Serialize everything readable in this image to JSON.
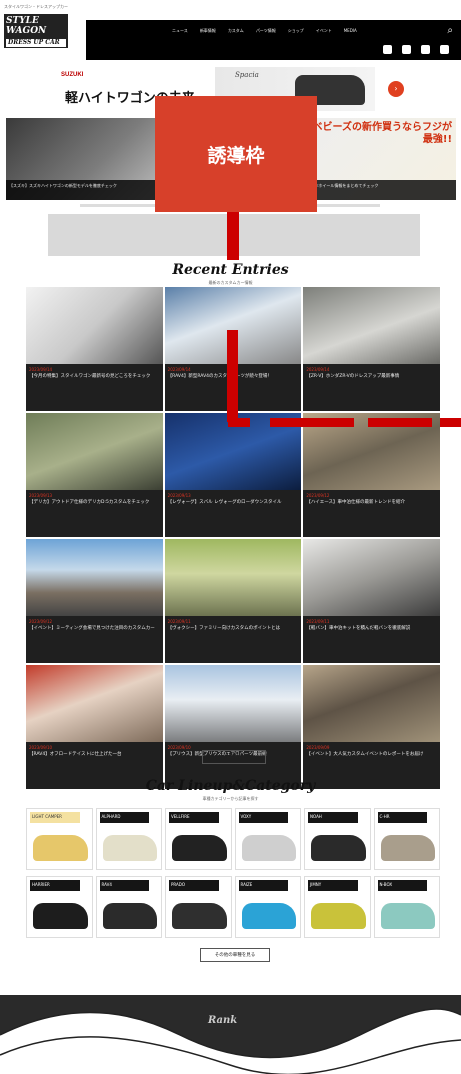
{
  "header": {
    "logo_tagline": "スタイルワゴン・ドレスアップカー",
    "logo_line1": "STYLE WAGON",
    "logo_line2": "DRESS UP CAR",
    "nav": [
      "ニュース",
      "新車情報",
      "カスタム",
      "パーツ情報",
      "ショップ",
      "イベント",
      "MEDIA"
    ]
  },
  "banner": {
    "brand": "SUZUKI",
    "headline": "軽ハイトワゴンの未来",
    "model": "Spacia"
  },
  "hero": {
    "slides": [
      {
        "caption": "【スズキ】スズキハイトワゴンの新型モデルを徹底チェック"
      },
      {
        "caption": ""
      },
      {
        "caption": "新作ホイール情報をまとめてチェック"
      }
    ],
    "promo": "ベビーズの新作買うならフジが最強!!"
  },
  "overlay": {
    "induction_label": "誘導枠"
  },
  "recent": {
    "title": "Recent Entries",
    "subtitle": "最新のカスタムカー情報",
    "entries": [
      {
        "date": "2023/09/14",
        "title": "【今月の特集】スタイルワゴン最新号の見どころをチェック"
      },
      {
        "date": "2023/09/14",
        "title": "【RAV4】新型RAV4のカスタムパーツが続々登場！"
      },
      {
        "date": "2023/09/14",
        "title": "【ZR-V】ホンダZR-Vのドレスアップ最新事情"
      },
      {
        "date": "2023/09/13",
        "title": "【デリカ】アウトドア仕様のデリカD:5カスタムをチェック"
      },
      {
        "date": "2023/09/13",
        "title": "【レヴォーグ】スバル レヴォーグのローダウンスタイル"
      },
      {
        "date": "2023/09/12",
        "title": "【ハイエース】車中泊仕様の最新トレンドを紹介"
      },
      {
        "date": "2023/09/12",
        "title": "【イベント】ミーティング会場で見つけた注目のカスタムカー"
      },
      {
        "date": "2023/09/11",
        "title": "【ヴォクシー】ファミリー向けカスタムのポイントとは"
      },
      {
        "date": "2023/09/11",
        "title": "【軽バン】車中泊キットを積んだ軽バンを徹底解説"
      },
      {
        "date": "2023/09/10",
        "title": "【RAV4】オフロードテイストに仕上げた一台"
      },
      {
        "date": "2023/09/10",
        "title": "【プリウス】新型プリウスのエアロパーツ最前線"
      },
      {
        "date": "2023/09/09",
        "title": "【イベント】大人気カスタムイベントのレポートをお届け"
      }
    ],
    "more_label": "MORE"
  },
  "lineup": {
    "title": "Car Lineup&Category",
    "subtitle": "車種カテゴリーから記事を探す",
    "items": [
      {
        "label": "LIGHT CAMPER"
      },
      {
        "label": "ALPHARD"
      },
      {
        "label": "VELLFIRE"
      },
      {
        "label": "VOXY"
      },
      {
        "label": "NOAH"
      },
      {
        "label": "C-HR"
      },
      {
        "label": "HARRIER"
      },
      {
        "label": "RAV4"
      },
      {
        "label": "PRADO"
      },
      {
        "label": "RAIZE"
      },
      {
        "label": "JIMNY"
      },
      {
        "label": "N-BOX"
      }
    ],
    "more_label": "その他の車種を見る"
  },
  "footer": {
    "logo": "Rank"
  }
}
